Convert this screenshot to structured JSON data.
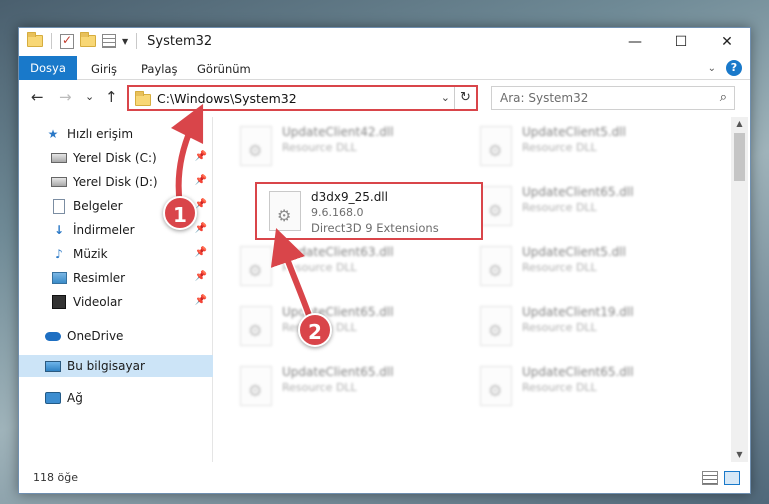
{
  "window": {
    "title": "System32",
    "controls": {
      "minimize": "—",
      "maximize": "☐",
      "close": "✕"
    }
  },
  "ribbon": {
    "tabs": [
      "Dosya",
      "Giriş",
      "Paylaş",
      "Görünüm"
    ],
    "expand_icon": "chevron-down-icon",
    "help_label": "?"
  },
  "navigation": {
    "back": "←",
    "forward": "→",
    "recent": "⌄",
    "up": "↑"
  },
  "address": {
    "path": "C:\\Windows\\System32",
    "dropdown": "⌄",
    "refresh": "↻"
  },
  "search": {
    "placeholder": "Ara: System32",
    "icon": "⌕"
  },
  "sidebar": {
    "items": [
      {
        "label": "Hızlı erişim",
        "icon": "star-icon",
        "pinned": false
      },
      {
        "label": "Yerel Disk (C:)",
        "icon": "disk-icon",
        "pinned": true
      },
      {
        "label": "Yerel Disk (D:)",
        "icon": "disk-icon",
        "pinned": true
      },
      {
        "label": "Belgeler",
        "icon": "document-icon",
        "pinned": true
      },
      {
        "label": "İndirmeler",
        "icon": "download-icon",
        "pinned": true
      },
      {
        "label": "Müzik",
        "icon": "music-icon",
        "pinned": true
      },
      {
        "label": "Resimler",
        "icon": "pictures-icon",
        "pinned": true
      },
      {
        "label": "Videolar",
        "icon": "videos-icon",
        "pinned": true
      },
      {
        "label": "OneDrive",
        "icon": "cloud-icon",
        "pinned": false
      },
      {
        "label": "Bu bilgisayar",
        "icon": "computer-icon",
        "pinned": false,
        "selected": true
      },
      {
        "label": "Ağ",
        "icon": "network-icon",
        "pinned": false
      }
    ],
    "pin_glyph": "📌"
  },
  "files": {
    "background": [
      {
        "name": "UpdateClient42.dll",
        "type": "Resource DLL"
      },
      {
        "name": "UpdateClient5.dll",
        "type": "Resource DLL"
      },
      {
        "name": "UpdateClient65.dll",
        "type": "Resource DLL"
      },
      {
        "name": "UpdateClient63.dll",
        "type": "Resource DLL"
      },
      {
        "name": "UpdateClient5.dll",
        "type": "Resource DLL"
      },
      {
        "name": "UpdateClient65.dll",
        "type": "Resource DLL"
      },
      {
        "name": "UpdateClient19.dll",
        "type": "Resource DLL"
      },
      {
        "name": "UpdateClient65.dll",
        "type": "Resource DLL"
      },
      {
        "name": "UpdateClient65.dll",
        "type": "Resource DLL"
      }
    ],
    "highlighted": {
      "name": "d3dx9_25.dll",
      "version": "9.6.168.0",
      "description": "Direct3D 9 Extensions"
    }
  },
  "status": {
    "item_count": "118 öğe"
  },
  "callouts": [
    "1",
    "2"
  ],
  "colors": {
    "accent": "#1979ca",
    "highlight": "#d9454a",
    "selection": "#cce4f7"
  }
}
